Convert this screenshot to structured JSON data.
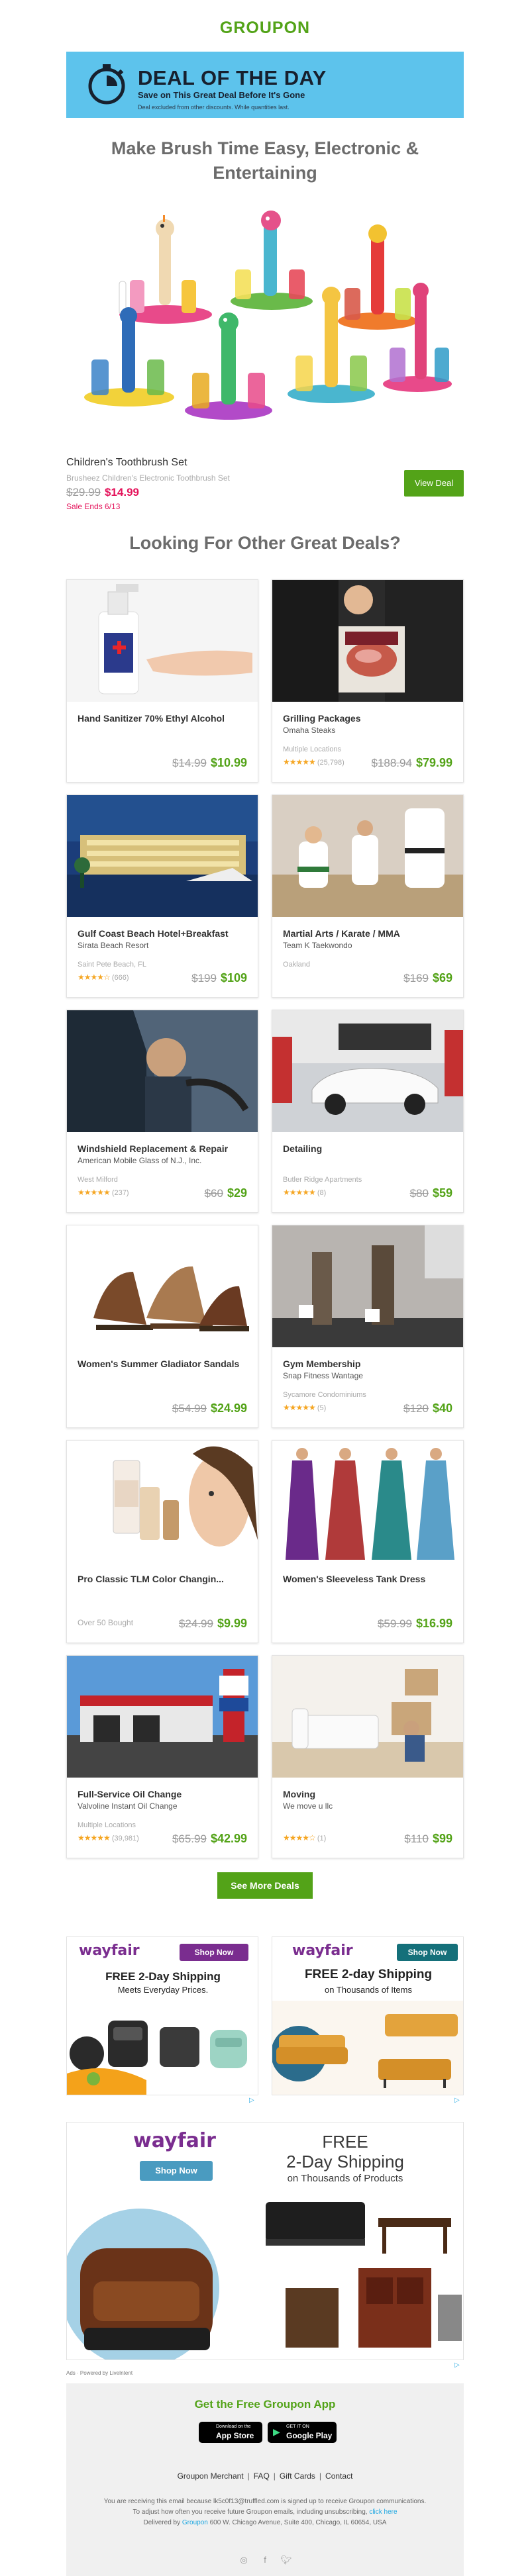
{
  "brand": {
    "logo": "GROUPON",
    "green": "#53a318",
    "pink": "#e4145b"
  },
  "dotd": {
    "title": "DEAL OF THE DAY",
    "subtitle": "Save on This Great Deal Before It's Gone",
    "note": "Deal excluded from other discounts. While quantities last."
  },
  "hero": {
    "title": "Make Brush Time Easy, Electronic & Entertaining",
    "product_name": "Children's Toothbrush Set",
    "product_sub": "Brusheez Children's Electronic Toothbrush Set",
    "was_price": "$29.99",
    "now_price": "$14.99",
    "ends": "Sale Ends 6/13",
    "view_button": "View Deal"
  },
  "others_title": "Looking For Other Great Deals?",
  "cards": [
    {
      "title": "Hand Sanitizer 70% Ethyl Alcohol",
      "merchant": "",
      "location": "",
      "rating_count": "",
      "sold": "",
      "was": "$14.99",
      "now": "$10.99",
      "image": "hand-sanitizer-image",
      "stars": 0
    },
    {
      "title": "Grilling Packages",
      "merchant": "Omaha Steaks",
      "location": "Multiple Locations",
      "rating_count": "(25,798)",
      "sold": "",
      "was": "$188.94",
      "now": "$79.99",
      "image": "steaks-image",
      "stars": 4.5
    },
    {
      "title": "Gulf Coast Beach Hotel+Breakfast",
      "merchant": "Sirata Beach Resort",
      "location": "Saint Pete Beach, FL",
      "rating_count": "(666)",
      "sold": "",
      "was": "$199",
      "now": "$109",
      "image": "hotel-image",
      "stars": 4
    },
    {
      "title": "Martial Arts / Karate / MMA",
      "merchant": "Team K Taekwondo",
      "location": "Oakland",
      "rating_count": "",
      "sold": "",
      "was": "$169",
      "now": "$69",
      "image": "karate-image",
      "stars": 0
    },
    {
      "title": "Windshield Replacement & Repair",
      "merchant": "American Mobile Glass of N.J., Inc.",
      "location": "West Milford",
      "rating_count": "(237)",
      "sold": "",
      "was": "$60",
      "now": "$29",
      "image": "car-driver-image",
      "stars": 5
    },
    {
      "title": "Detailing",
      "merchant": "",
      "location": "Butler Ridge Apartments",
      "rating_count": "(8)",
      "sold": "",
      "was": "$80",
      "now": "$59",
      "image": "white-car-image",
      "stars": 5
    },
    {
      "title": "Women's Summer Gladiator Sandals",
      "merchant": "",
      "location": "",
      "rating_count": "",
      "sold": "",
      "was": "$54.99",
      "now": "$24.99",
      "image": "sandals-image",
      "stars": 0
    },
    {
      "title": "Gym Membership",
      "merchant": "Snap Fitness Wantage",
      "location": "Sycamore Condominiums",
      "rating_count": "(5)",
      "sold": "",
      "was": "$120",
      "now": "$40",
      "image": "treadmill-image",
      "stars": 5
    },
    {
      "title": "Pro Classic TLM Color Changin...",
      "merchant": "",
      "location": "",
      "rating_count": "",
      "sold": "Over 50 Bought",
      "was": "$24.99",
      "now": "$9.99",
      "image": "cosmetics-image",
      "stars": 0
    },
    {
      "title": "Women's Sleeveless Tank Dress",
      "merchant": "",
      "location": "",
      "rating_count": "",
      "sold": "",
      "was": "$59.99",
      "now": "$16.99",
      "image": "dresses-image",
      "stars": 0
    },
    {
      "title": "Full-Service Oil Change",
      "merchant": "Valvoline Instant Oil Change",
      "location": "Multiple Locations",
      "rating_count": "(39,981)",
      "sold": "",
      "was": "$65.99",
      "now": "$42.99",
      "image": "oil-station-image",
      "stars": 4.5
    },
    {
      "title": "Moving",
      "merchant": "We move u llc",
      "location": "",
      "rating_count": "(1)",
      "sold": "",
      "was": "$110",
      "now": "$99",
      "image": "moving-image",
      "stars": 4
    }
  ],
  "more_button": "See More Deals",
  "ads": {
    "brand": "wayfair",
    "shop_now": "Shop Now",
    "ad1_head": "FREE 2-Day Shipping",
    "ad1_sub": "Meets Everyday Prices.",
    "ad2_head": "FREE 2-day Shipping",
    "ad2_sub": "on Thousands of Items",
    "ad3_head1": "FREE",
    "ad3_head2": "2-Day Shipping",
    "ad3_sub": "on Thousands of Products",
    "powered": "Ads · Powered by LiveIntent"
  },
  "footer": {
    "app_title": "Get the Free Groupon App",
    "app_store_small": "Download on the",
    "app_store": "App Store",
    "play_small": "GET IT ON",
    "play": "Google Play",
    "links": [
      "Groupon Merchant",
      "FAQ",
      "Gift Cards",
      "Contact"
    ],
    "fine1": "You are receiving this email because lk5c0f13@truffled.com is signed up to receive Groupon communications.",
    "fine2": "To adjust how often you receive future Groupon emails, including unsubscribing,",
    "fine2_link": "click here",
    "fine3_pre": "Delivered by",
    "fine3_link": "Groupon",
    "fine3_post": "600 W. Chicago Avenue, Suite 400, Chicago, IL 60654, USA"
  }
}
